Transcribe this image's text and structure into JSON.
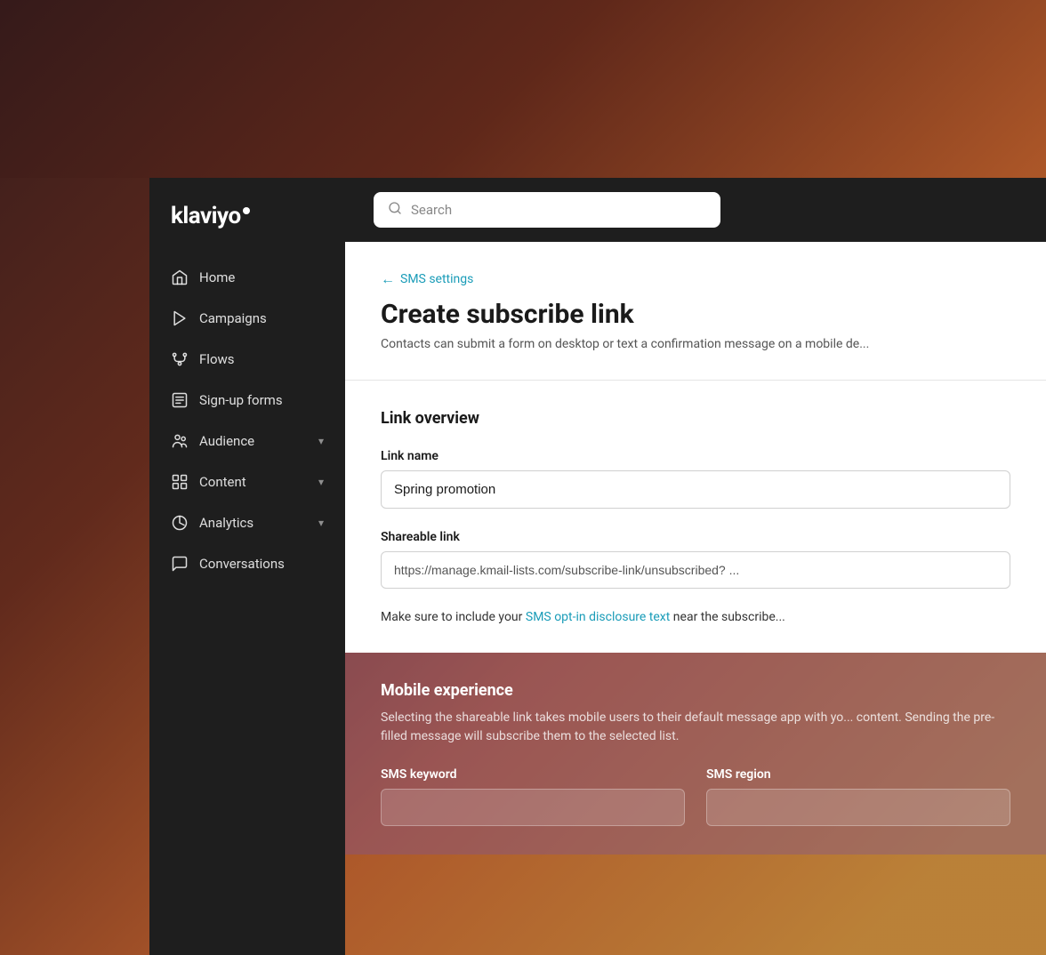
{
  "app": {
    "name": "klaviyo",
    "logo_text": "klaviyo"
  },
  "header": {
    "search_placeholder": "Search"
  },
  "sidebar": {
    "items": [
      {
        "id": "home",
        "label": "Home",
        "icon": "home-icon",
        "hasChevron": false
      },
      {
        "id": "campaigns",
        "label": "Campaigns",
        "icon": "campaigns-icon",
        "hasChevron": false
      },
      {
        "id": "flows",
        "label": "Flows",
        "icon": "flows-icon",
        "hasChevron": false
      },
      {
        "id": "signup-forms",
        "label": "Sign-up forms",
        "icon": "forms-icon",
        "hasChevron": false
      },
      {
        "id": "audience",
        "label": "Audience",
        "icon": "audience-icon",
        "hasChevron": true
      },
      {
        "id": "content",
        "label": "Content",
        "icon": "content-icon",
        "hasChevron": true
      },
      {
        "id": "analytics",
        "label": "Analytics",
        "icon": "analytics-icon",
        "hasChevron": true
      },
      {
        "id": "conversations",
        "label": "Conversations",
        "icon": "conversations-icon",
        "hasChevron": false
      }
    ]
  },
  "page": {
    "back_link": "SMS settings",
    "title": "Create subscribe link",
    "subtitle": "Contacts can submit a form on desktop or text a confirmation message on a mobile de..."
  },
  "link_overview": {
    "section_title": "Link overview",
    "link_name_label": "Link name",
    "link_name_value": "Spring promotion",
    "shareable_link_label": "Shareable link",
    "shareable_link_value": "https://manage.kmail-lists.com/subscribe-link/unsubscribed? ...",
    "disclosure_text": "Make sure to include your ",
    "disclosure_link_text": "SMS opt-in disclosure text",
    "disclosure_suffix": " near the subscribe..."
  },
  "mobile_experience": {
    "title": "Mobile experience",
    "description": "Selecting the shareable link takes mobile users to their default message app with yo... content. Sending the pre-filled message will subscribe them to the selected list.",
    "sms_keyword_label": "SMS keyword",
    "sms_region_label": "SMS region"
  }
}
